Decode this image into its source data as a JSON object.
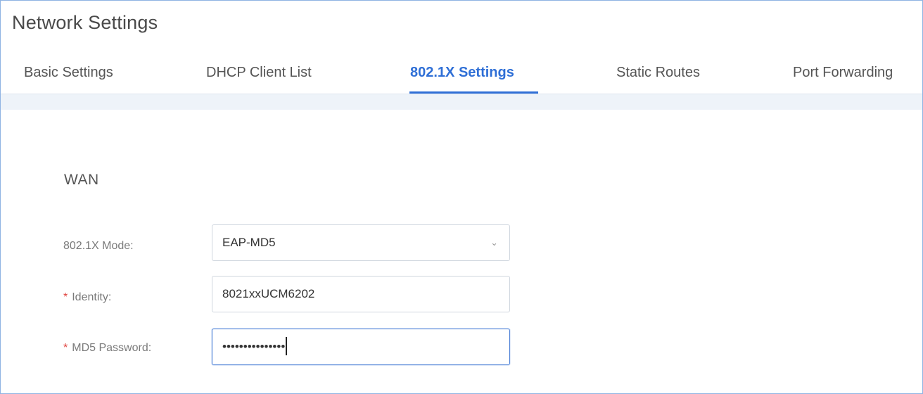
{
  "page": {
    "title": "Network Settings"
  },
  "tabs": [
    {
      "label": "Basic Settings",
      "active": false
    },
    {
      "label": "DHCP Client List",
      "active": false
    },
    {
      "label": "802.1X Settings",
      "active": true
    },
    {
      "label": "Static Routes",
      "active": false
    },
    {
      "label": "Port Forwarding",
      "active": false
    }
  ],
  "section": {
    "title": "WAN"
  },
  "form": {
    "mode": {
      "label": "802.1X Mode:",
      "value": "EAP-MD5",
      "required": false
    },
    "identity": {
      "required_mark": "*",
      "label": "Identity:",
      "value": "8021xxUCM6202",
      "required": true
    },
    "password": {
      "required_mark": "*",
      "label": "MD5 Password:",
      "masked_value": "•••••••••••••••",
      "required": true
    }
  },
  "icons": {
    "select_arrow": "chevron-down-icon"
  },
  "colors": {
    "accent": "#2f6fd6",
    "required": "#e0443f",
    "frame_border": "#8fb3e3",
    "strip": "#eef3f9"
  }
}
